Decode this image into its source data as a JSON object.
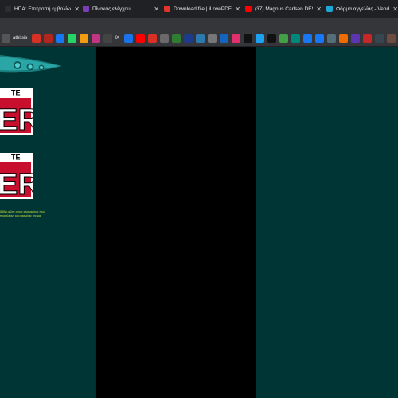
{
  "tabs": [
    {
      "title": "ΗΠΑ: Επιτροπή εμβολίων",
      "favicon_color": "#2e2e2e",
      "favicon": "globe-icon"
    },
    {
      "title": "Πίνακας ελέγχου",
      "favicon_color": "#7b3fb5",
      "favicon": "dashboard-icon"
    },
    {
      "title": "Download file | iLovePDF",
      "favicon_color": "#e5322d",
      "favicon": "heart-icon"
    },
    {
      "title": "(37) Magnus Carlsen DES",
      "favicon_color": "#ff0000",
      "favicon": "youtube-icon"
    },
    {
      "title": "Φόρμα αγγελίας - Vendo",
      "favicon_color": "#1ca7d6",
      "favicon": "vendo-icon"
    }
  ],
  "bookmarks": [
    {
      "icon": "athlisis-icon",
      "color": "#555555",
      "label": "athlisis"
    },
    {
      "icon": "gmail-icon",
      "color": "#d93025"
    },
    {
      "icon": "close-red-icon",
      "color": "#b3261e"
    },
    {
      "icon": "facebook-icon",
      "color": "#1877f2"
    },
    {
      "icon": "whatsapp-icon",
      "color": "#25d366"
    },
    {
      "icon": "rss-icon",
      "color": "#f39c12"
    },
    {
      "icon": "instagram-icon",
      "color": "#c13584"
    },
    {
      "icon": "ix-icon",
      "color": "#444444",
      "label": "IX"
    },
    {
      "icon": "mail-icon",
      "color": "#1a73e8"
    },
    {
      "icon": "youtube-icon",
      "color": "#ff0000"
    },
    {
      "icon": "flag-icon",
      "color": "#d93025"
    },
    {
      "icon": "image-icon",
      "color": "#6a6a6a"
    },
    {
      "icon": "slash-icon",
      "color": "#2e7d32"
    },
    {
      "icon": "bold-b-icon",
      "color": "#1e3a8a"
    },
    {
      "icon": "grid-icon",
      "color": "#2a7ab0"
    },
    {
      "icon": "photo-icon",
      "color": "#777777"
    },
    {
      "icon": "chart-icon",
      "color": "#1565c0"
    },
    {
      "icon": "camera-icon",
      "color": "#e1306c"
    },
    {
      "icon": "tiktok-icon",
      "color": "#111111"
    },
    {
      "icon": "bird-icon",
      "color": "#1da1f2"
    },
    {
      "icon": "x-icon",
      "color": "#111111"
    },
    {
      "icon": "mountain-icon",
      "color": "#43a047"
    },
    {
      "icon": "check-square-icon",
      "color": "#00897b"
    },
    {
      "icon": "facebook-icon",
      "color": "#1877f2"
    },
    {
      "icon": "facebook-icon",
      "color": "#1877f2"
    },
    {
      "icon": "image-icon",
      "color": "#546e7a"
    },
    {
      "icon": "link-icon",
      "color": "#ef6c00"
    },
    {
      "icon": "grid-icon",
      "color": "#5e35b1"
    },
    {
      "icon": "tag-icon",
      "color": "#c62828"
    },
    {
      "icon": "square-icon",
      "color": "#37474f"
    },
    {
      "icon": "box-icon",
      "color": "#6d4c41"
    },
    {
      "icon": "ne-icon",
      "color": "#1565c0"
    }
  ],
  "page": {
    "logo_text_top": "TE",
    "logo_text_big": "ER",
    "greek_line_1": "βιβλίο φίλης στους ιανουαρίους που",
    "greek_line_2": "περιπλέουν και ορισμένες της μα"
  }
}
